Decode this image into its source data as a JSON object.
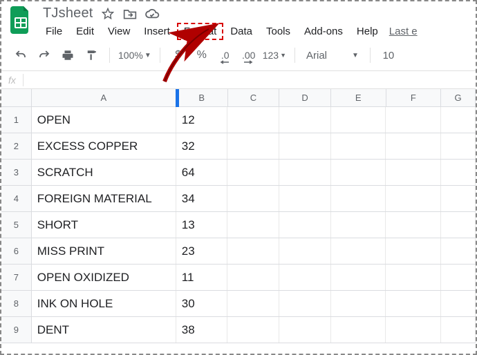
{
  "doc": {
    "title": "TJsheet"
  },
  "menu": {
    "file": "File",
    "edit": "Edit",
    "view": "View",
    "insert": "Insert",
    "format": "Format",
    "data": "Data",
    "tools": "Tools",
    "addons": "Add-ons",
    "help": "Help",
    "last_edit": "Last e"
  },
  "toolbar": {
    "zoom": "100%",
    "currency": "$",
    "percent": "%",
    "dec_less": ".0",
    "dec_more": ".00",
    "numfmt": "123",
    "font": "Arial",
    "fontsize": "10"
  },
  "fx": {
    "label": "fx"
  },
  "columns": [
    "A",
    "B",
    "C",
    "D",
    "E",
    "F",
    "G"
  ],
  "rows": [
    {
      "n": "1",
      "a": "OPEN",
      "b": "12"
    },
    {
      "n": "2",
      "a": "EXCESS COPPER",
      "b": "32"
    },
    {
      "n": "3",
      "a": "SCRATCH",
      "b": "64"
    },
    {
      "n": "4",
      "a": "FOREIGN MATERIAL",
      "b": "34"
    },
    {
      "n": "5",
      "a": "SHORT",
      "b": "13"
    },
    {
      "n": "6",
      "a": "MISS PRINT",
      "b": "23"
    },
    {
      "n": "7",
      "a": "OPEN OXIDIZED",
      "b": "11"
    },
    {
      "n": "8",
      "a": "INK ON HOLE",
      "b": "30"
    },
    {
      "n": "9",
      "a": "DENT",
      "b": "38"
    }
  ]
}
